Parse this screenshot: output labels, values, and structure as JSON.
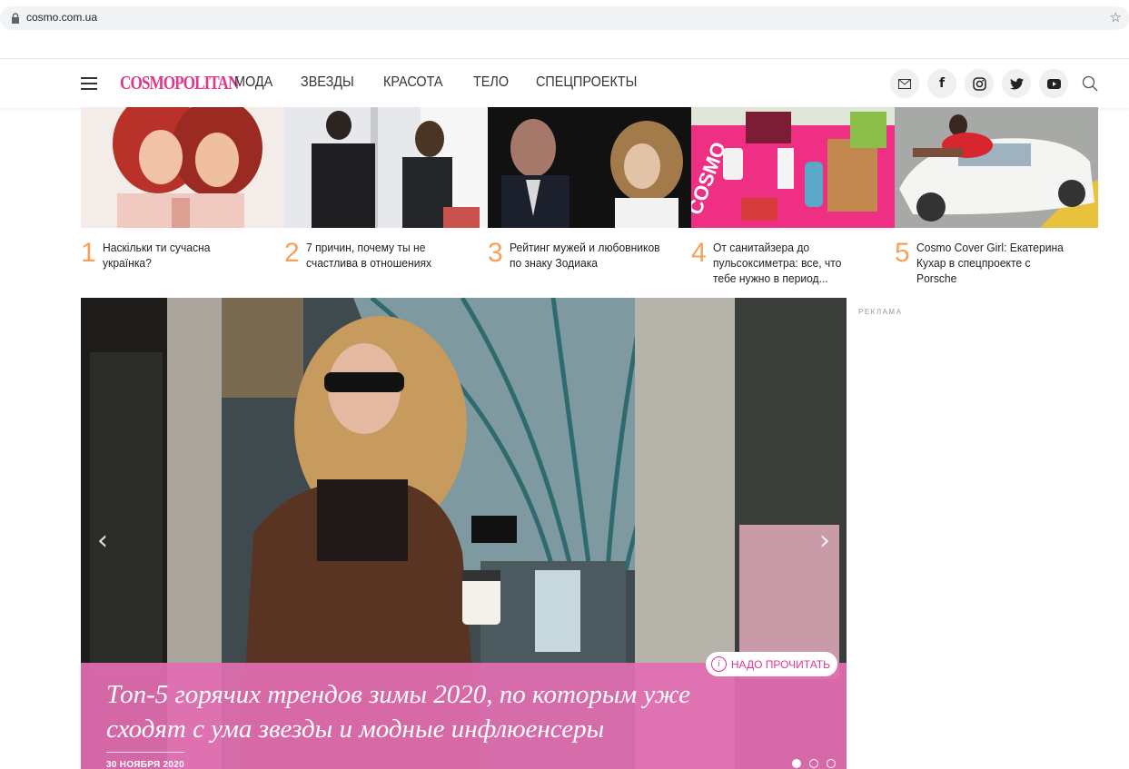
{
  "browser": {
    "url": "cosmo.com.ua"
  },
  "header": {
    "logo": "COSMOPOLITAN",
    "nav": [
      "МОДА",
      "ЗВЕЗДЫ",
      "КРАСОТА",
      "ТЕЛО",
      "СПЕЦПРОЕКТЫ"
    ],
    "social_icons": [
      "mail-icon",
      "facebook-icon",
      "instagram-icon",
      "twitter-icon",
      "youtube-icon"
    ],
    "search_icon": "search-icon"
  },
  "top_stories": [
    {
      "num": "1",
      "title": "Наскільки ти сучасна українка?"
    },
    {
      "num": "2",
      "title": "7 причин, почему ты не счастлива в отношениях"
    },
    {
      "num": "3",
      "title": "Рейтинг мужей и любовников по знаку Зодиака"
    },
    {
      "num": "4",
      "title": "От санитайзера до пульсоксиметра: все, что тебе нужно в период..."
    },
    {
      "num": "5",
      "title": "Cosmo Cover Girl: Екатерина Кухар в спецпроекте с Porsche"
    }
  ],
  "hero": {
    "badge": "НАДО ПРОЧИТАТЬ",
    "headline": "Топ-5 горячих трендов зимы 2020, по которым уже сходят с ума звезды и модные инфлюенсеры",
    "date": "30 НОЯБРЯ 2020",
    "slides": 3,
    "active_slide": 1
  },
  "sidebar": {
    "ad_label": "РЕКЛАМА"
  },
  "colors": {
    "brand": "#e0378a",
    "accent_number": "#f5a15b",
    "hero_panel": "#e26eb1"
  }
}
